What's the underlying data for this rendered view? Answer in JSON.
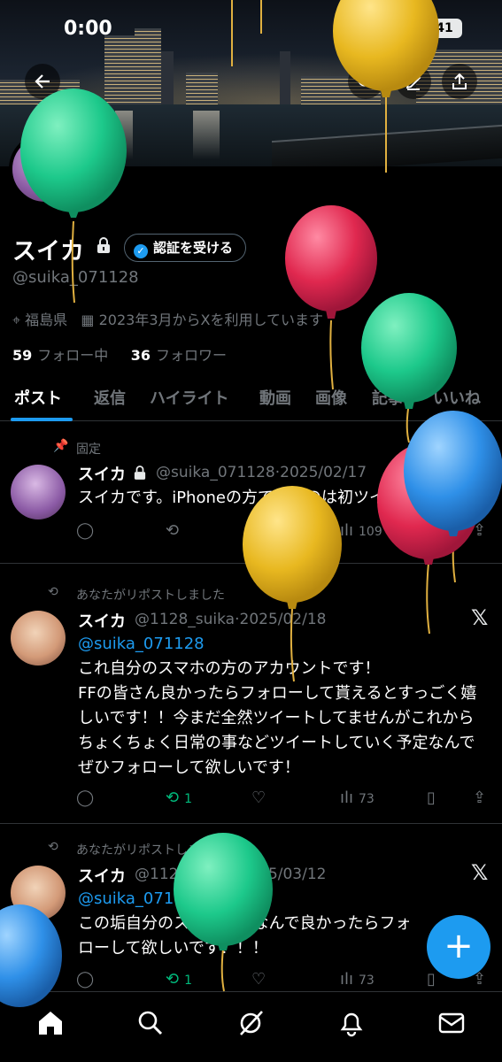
{
  "status_bar": {
    "time": "0:00",
    "battery": "41"
  },
  "profile": {
    "name": "スイカ",
    "verify_button": "認証を受ける",
    "handle": "@suika_071128",
    "location": "福島県",
    "joined": "2023年3月からXを利用しています",
    "following_count": "59",
    "following_label": "フォロー中",
    "followers_count": "36",
    "followers_label": "フォロワー"
  },
  "tabs": [
    "ポスト",
    "返信",
    "ハイライト",
    "動画",
    "画像",
    "記事",
    "いいね"
  ],
  "posts": [
    {
      "context": "固定",
      "name": "スイカ",
      "handle": "@suika_071128",
      "date": "2025/02/17",
      "text": "スイカです。iPhoneの方でやるのは初ツイ",
      "replies": "",
      "reposts": "",
      "likes": "2",
      "views": "109"
    },
    {
      "context": "あなたがリポストしました",
      "name": "スイカ",
      "handle": "@1128_suika",
      "date": "2025/02/18",
      "mention": "@suika_071128",
      "text": "これ自分のスマホの方のアカウントです！\nFFの皆さん良かったらフォローして貰えるとすっごく嬉しいです！！今まだ全然ツイートしてませんがこれからちょくちょく日常の事などツイートしていく予定なんでぜひフォローして欲しいです！",
      "replies": "",
      "reposts": "1",
      "likes": "",
      "views": "73"
    },
    {
      "context": "あなたがリポストしました",
      "name": "スイカ",
      "handle": "@1128_suika",
      "date": "2025/03/12",
      "mention": "@suika_071128",
      "text": "この垢自分のスマホの垢なんで良かったらフォローして欲しいです！！！",
      "replies": "",
      "reposts": "1",
      "likes": "",
      "views": "73"
    }
  ],
  "colors": {
    "accent": "#1d9bf0",
    "repost_green": "#00ba7c",
    "muted": "#71767b",
    "background": "#000000"
  },
  "icons": {
    "header": [
      "back-arrow-icon",
      "search-icon",
      "edit-icon",
      "share-icon"
    ],
    "bottom_nav": [
      "home-icon",
      "search-icon",
      "grok-icon",
      "notifications-icon",
      "messages-icon"
    ]
  }
}
